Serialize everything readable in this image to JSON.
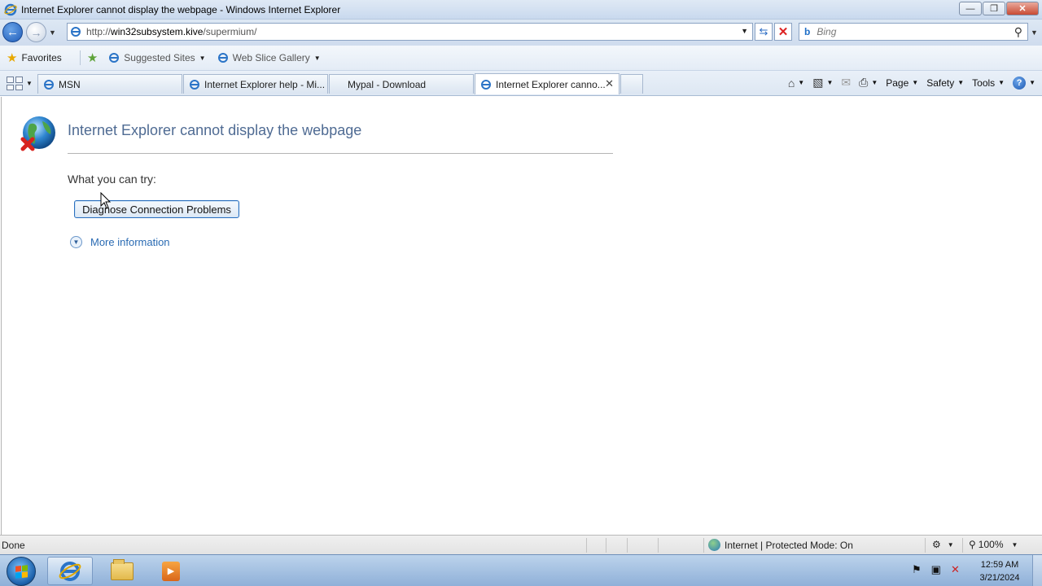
{
  "window": {
    "title": "Internet Explorer cannot display the webpage - Windows Internet Explorer",
    "controls": {
      "minimize": "—",
      "restore": "❐",
      "close": "✕"
    }
  },
  "navbar": {
    "url_prefix": "http://",
    "url_domain": "win32subsystem.kive",
    "url_path": "/supermium/",
    "search_placeholder": "Bing",
    "search_provider_icon": "b"
  },
  "favorites_bar": {
    "favorites_label": "Favorites",
    "items": [
      {
        "label": "Suggested Sites"
      },
      {
        "label": "Web Slice Gallery"
      }
    ]
  },
  "tabs": [
    {
      "label": "MSN"
    },
    {
      "label": "Internet Explorer help - Mi..."
    },
    {
      "label": "Mypal - Download"
    },
    {
      "label": "Internet Explorer canno..."
    }
  ],
  "command_bar": {
    "page": "Page",
    "safety": "Safety",
    "tools": "Tools",
    "help": "?"
  },
  "content": {
    "heading": "Internet Explorer cannot display the webpage",
    "try_label": "What you can try:",
    "diagnose_button": "Diagnose Connection Problems",
    "more_info": "More information"
  },
  "statusbar": {
    "status": "Done",
    "zone": "Internet | Protected Mode: On",
    "zoom": "100%"
  },
  "taskbar": {
    "time": "12:59 AM",
    "date": "3/21/2024"
  },
  "colors": {
    "heading": "#4f6b93",
    "link": "#2a6bb3",
    "button_border": "#2a6fbe"
  }
}
